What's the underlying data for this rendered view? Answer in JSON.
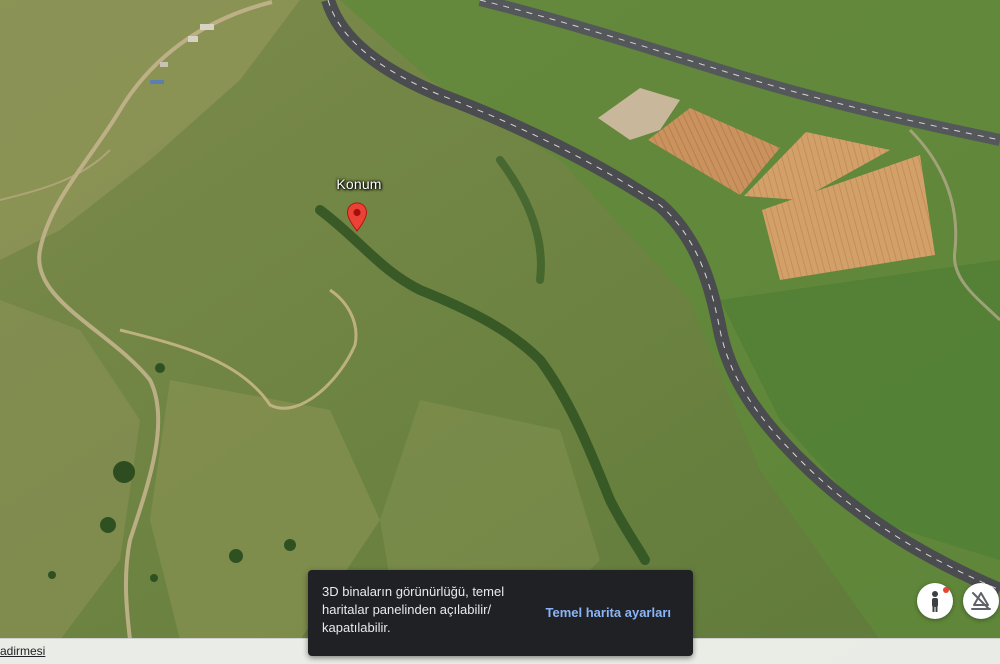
{
  "map": {
    "view": "satellite-3d",
    "marker": {
      "label": "Konum",
      "icon": "map-pin-icon",
      "color": "#ea4335"
    }
  },
  "toast": {
    "message": "3D binaların görünürlüğü, temel\nharitalar panelinden açılabilir/\nkapatılabilir.",
    "action_label": "Temel harita ayarları",
    "action_color": "#8ab4f8",
    "background": "#202124"
  },
  "controls": {
    "pegman_icon": "pegman-icon",
    "tilt_icon": "tilt-3d-icon"
  },
  "footer": {
    "link_text": "adirmesi"
  }
}
